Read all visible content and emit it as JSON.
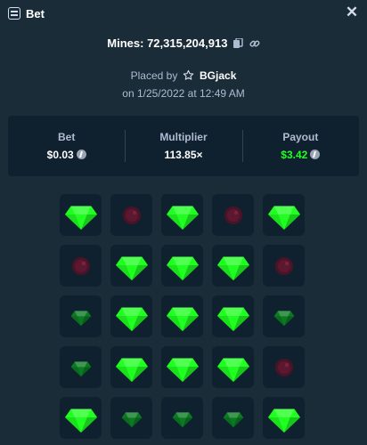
{
  "header": {
    "title": "Bet",
    "icon": "bet-slip-icon",
    "close_icon": "close-icon",
    "close_glyph": "✕"
  },
  "summary": {
    "mines_text": "Mines: 72,315,204,913",
    "placed_by_label": "Placed by",
    "username": "BGjack",
    "date": "on 1/25/2022 at 12:49 AM"
  },
  "stats": {
    "bet_label": "Bet",
    "bet_value": "$0.03",
    "multiplier_label": "Multiplier",
    "multiplier_value": "113.85×",
    "payout_label": "Payout",
    "payout_value": "$3.42",
    "currency_icon": "litecoin-icon"
  },
  "colors": {
    "background": "#1a2c38",
    "panel": "#0f212e",
    "gem_revealed": "#1fff20",
    "gem_unrevealed": "#0b7a22",
    "mine": "#4a1326",
    "payout": "#1fff20"
  },
  "board": {
    "rows": [
      [
        "gem",
        "mine-dim",
        "gem",
        "mine-dim",
        "gem"
      ],
      [
        "mine-dim",
        "gem",
        "gem",
        "gem",
        "mine-dim"
      ],
      [
        "gem-dim",
        "gem",
        "gem",
        "gem",
        "gem-dim"
      ],
      [
        "gem-dim",
        "gem",
        "gem",
        "gem",
        "mine-dim"
      ],
      [
        "gem",
        "gem-dim",
        "gem-dim",
        "gem-dim",
        "gem"
      ]
    ]
  }
}
